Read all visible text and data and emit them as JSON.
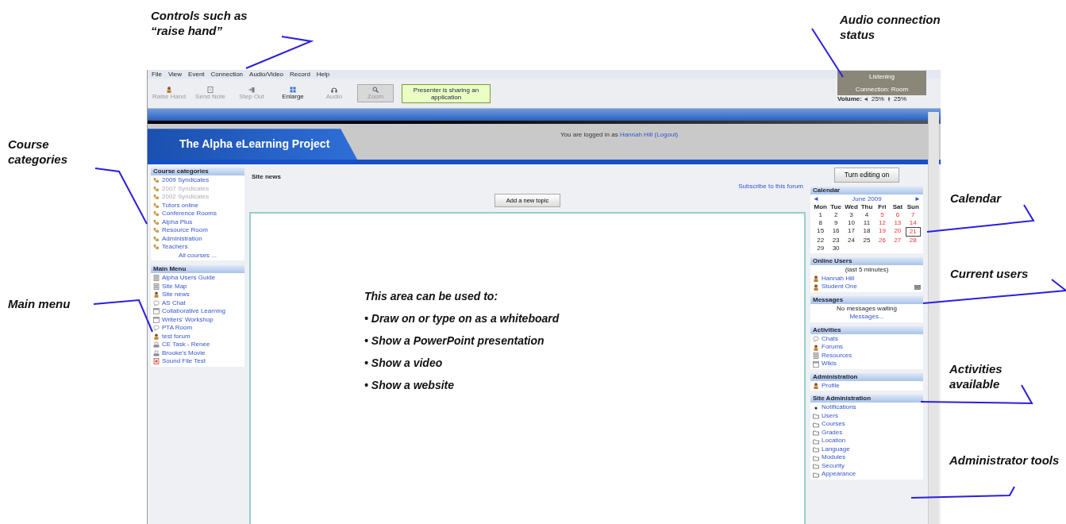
{
  "annotations": [
    {
      "text": "Controls such as “raise hand”"
    },
    {
      "text": "Audio connection status"
    },
    {
      "text": "Course categories"
    },
    {
      "text": "Main menu"
    },
    {
      "text": "Calendar"
    },
    {
      "text": "Current users"
    },
    {
      "text": "Activities available"
    },
    {
      "text": "Administrator tools"
    }
  ],
  "menu_bar": [
    "File",
    "View",
    "Event",
    "Connection",
    "Audio/Video",
    "Record",
    "Help"
  ],
  "toolbar": [
    {
      "label": "Raise Hand",
      "kind": "person",
      "disabled": true,
      "selected": false
    },
    {
      "label": "Send Note",
      "kind": "note",
      "disabled": true,
      "selected": false
    },
    {
      "label": "Step Out",
      "kind": "exit",
      "disabled": true,
      "selected": false
    },
    {
      "label": "Enlarge",
      "kind": "grid",
      "disabled": false,
      "selected": false
    },
    {
      "label": "Audio",
      "kind": "headset",
      "disabled": true,
      "selected": false
    },
    {
      "label": "Zoom",
      "kind": "magnifier",
      "disabled": true,
      "selected": true
    }
  ],
  "presenter_status": "Presenter is sharing an application",
  "audio_status": {
    "state": "Listening",
    "connection": "Connection: Room",
    "volume_label": "Volume:",
    "speaker_level": "25%",
    "mic_level": "25%"
  },
  "site": {
    "title": "The Alpha eLearning Project",
    "login_text": "You are logged in as",
    "user": "Hannah Hill",
    "logout": "(Logout)"
  },
  "course_categories": {
    "title": "Course categories",
    "items": [
      {
        "label": "2009 Syndicates",
        "disabled": false
      },
      {
        "label": "2007 Syndicates",
        "disabled": true
      },
      {
        "label": "2002 Syndicates",
        "disabled": true
      },
      {
        "label": "Tutors online",
        "disabled": false
      },
      {
        "label": "Conference Rooms",
        "disabled": false
      },
      {
        "label": "Alpha Plus",
        "disabled": false
      },
      {
        "label": "Resource Room",
        "disabled": false
      },
      {
        "label": "Administration",
        "disabled": false
      },
      {
        "label": "Teachers",
        "disabled": false
      }
    ],
    "more": "All courses ..."
  },
  "main_menu": {
    "title": "Main Menu",
    "items": [
      {
        "label": "Alpha Users Guide",
        "kind": "page"
      },
      {
        "label": "Site Map",
        "kind": "page"
      },
      {
        "label": "Site news",
        "kind": "forum"
      },
      {
        "label": "AS Chat",
        "kind": "chat"
      },
      {
        "label": "Collaborative Learning",
        "kind": "window"
      },
      {
        "label": "Writers' Workshop",
        "kind": "window"
      },
      {
        "label": "PTA Room",
        "kind": "chat"
      },
      {
        "label": "test forum",
        "kind": "forum"
      },
      {
        "label": "CE Task - Renee",
        "kind": "tray"
      },
      {
        "label": "Brooke's Movie",
        "kind": "tray"
      },
      {
        "label": "Sound File Test",
        "kind": "file"
      }
    ]
  },
  "site_news": {
    "title": "Site news",
    "subscribe": "Subscribe to this forum",
    "button": "Add a new topic"
  },
  "whiteboard": {
    "heading": "This area can be used to:",
    "items": [
      "• Draw on or type on as a whiteboard",
      "• Show a PowerPoint presentation",
      "• Show a video",
      "• Show a website"
    ]
  },
  "edit_button": "Turn editing on",
  "calendar": {
    "title": "Calendar",
    "prev": "◄",
    "next": "►",
    "month": "June 2009",
    "weekdays": [
      "Mon",
      "Tue",
      "Wed",
      "Thu",
      "Fri",
      "Sat",
      "Sun"
    ],
    "weeks": [
      [
        {
          "day": "1",
          "weekend": false,
          "today": false
        },
        {
          "day": "2",
          "weekend": false,
          "today": false
        },
        {
          "day": "3",
          "weekend": false,
          "today": false
        },
        {
          "day": "4",
          "weekend": false,
          "today": false
        },
        {
          "day": "5",
          "weekend": true,
          "today": false
        },
        {
          "day": "6",
          "weekend": true,
          "today": false
        },
        {
          "day": "7",
          "weekend": true,
          "today": false
        }
      ],
      [
        {
          "day": "8",
          "weekend": false,
          "today": false
        },
        {
          "day": "9",
          "weekend": false,
          "today": false
        },
        {
          "day": "10",
          "weekend": false,
          "today": false
        },
        {
          "day": "11",
          "weekend": false,
          "today": false
        },
        {
          "day": "12",
          "weekend": true,
          "today": false
        },
        {
          "day": "13",
          "weekend": true,
          "today": false
        },
        {
          "day": "14",
          "weekend": true,
          "today": false
        }
      ],
      [
        {
          "day": "15",
          "weekend": false,
          "today": false
        },
        {
          "day": "16",
          "weekend": false,
          "today": false
        },
        {
          "day": "17",
          "weekend": false,
          "today": false
        },
        {
          "day": "18",
          "weekend": false,
          "today": false
        },
        {
          "day": "19",
          "weekend": true,
          "today": false
        },
        {
          "day": "20",
          "weekend": true,
          "today": false
        },
        {
          "day": "21",
          "weekend": true,
          "today": true
        }
      ],
      [
        {
          "day": "22",
          "weekend": false,
          "today": false
        },
        {
          "day": "23",
          "weekend": false,
          "today": false
        },
        {
          "day": "24",
          "weekend": false,
          "today": false
        },
        {
          "day": "25",
          "weekend": false,
          "today": false
        },
        {
          "day": "26",
          "weekend": true,
          "today": false
        },
        {
          "day": "27",
          "weekend": true,
          "today": false
        },
        {
          "day": "28",
          "weekend": true,
          "today": false
        }
      ],
      [
        {
          "day": "29",
          "weekend": false,
          "today": false
        },
        {
          "day": "30",
          "weekend": false,
          "today": false
        }
      ]
    ]
  },
  "online_users": {
    "title": "Online Users",
    "period": "(last 5 minutes)",
    "users": [
      "Hannah Hill",
      "Student One"
    ]
  },
  "messages": {
    "title": "Messages",
    "text": "No messages waiting",
    "link": "Messages..."
  },
  "activities": {
    "title": "Activities",
    "items": [
      {
        "label": "Chats",
        "kind": "chat"
      },
      {
        "label": "Forums",
        "kind": "forum"
      },
      {
        "label": "Resources",
        "kind": "page"
      },
      {
        "label": "Wikis",
        "kind": "window"
      }
    ]
  },
  "administration": {
    "title": "Administration",
    "items": [
      {
        "label": "Profile",
        "kind": "person"
      }
    ]
  },
  "site_administration": {
    "title": "Site Administration",
    "items": [
      {
        "label": "Notifications",
        "kind": "dot"
      },
      {
        "label": "Users",
        "kind": "folder"
      },
      {
        "label": "Courses",
        "kind": "folder"
      },
      {
        "label": "Grades",
        "kind": "folder"
      },
      {
        "label": "Location",
        "kind": "folder"
      },
      {
        "label": "Language",
        "kind": "folder"
      },
      {
        "label": "Modules",
        "kind": "folder"
      },
      {
        "label": "Security",
        "kind": "folder"
      },
      {
        "label": "Appearance",
        "kind": "folder"
      }
    ]
  }
}
